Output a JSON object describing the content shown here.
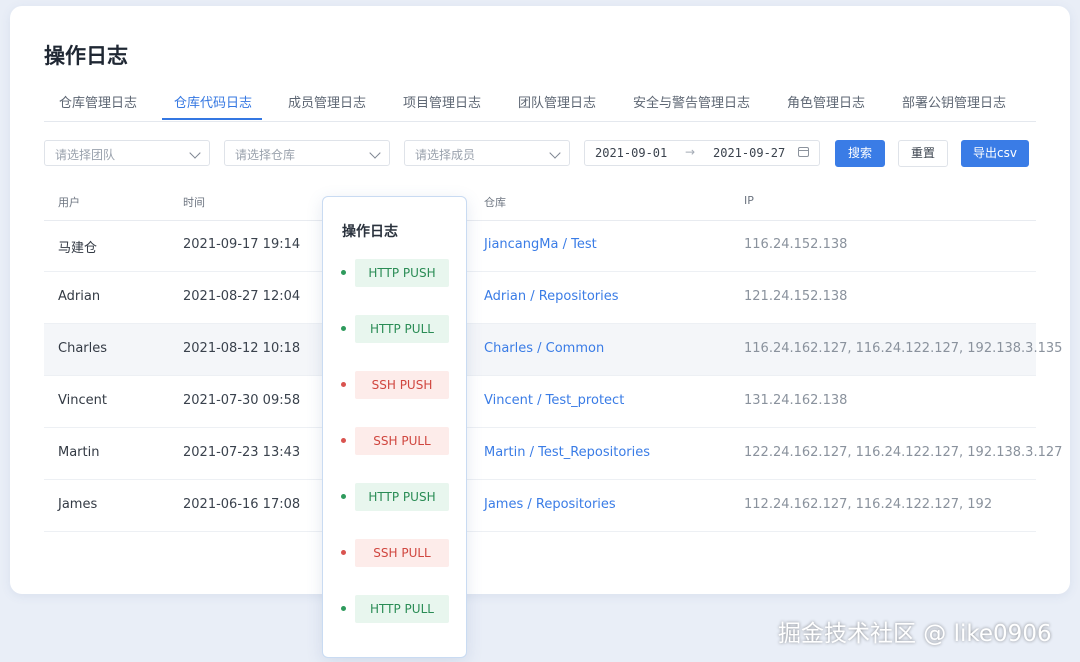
{
  "page": {
    "title": "操作日志"
  },
  "tabs": [
    {
      "label": "仓库管理日志"
    },
    {
      "label": "仓库代码日志"
    },
    {
      "label": "成员管理日志"
    },
    {
      "label": "项目管理日志"
    },
    {
      "label": "团队管理日志"
    },
    {
      "label": "安全与警告管理日志"
    },
    {
      "label": "角色管理日志"
    },
    {
      "label": "部署公钥管理日志"
    }
  ],
  "filters": {
    "team_placeholder": "请选择团队",
    "repo_placeholder": "请选择仓库",
    "member_placeholder": "请选择成员",
    "date_start": "2021-09-01",
    "date_arrow": "→",
    "date_end": "2021-09-27",
    "search_label": "搜索",
    "reset_label": "重置",
    "export_label": "导出csv"
  },
  "table": {
    "headers": {
      "user": "用户",
      "time": "时间",
      "repo": "仓库",
      "ip": "IP"
    },
    "rows": [
      {
        "user": "马建仓",
        "time": "2021-09-17 19:14",
        "repo": "JiancangMa / Test",
        "ip": "116.24.152.138"
      },
      {
        "user": "Adrian",
        "time": "2021-08-27 12:04",
        "repo": "Adrian / Repositories",
        "ip": "121.24.152.138"
      },
      {
        "user": "Charles",
        "time": "2021-08-12 10:18",
        "repo": "Charles / Common",
        "ip": "116.24.162.127, 116.24.122.127, 192.138.3.135"
      },
      {
        "user": "Vincent",
        "time": "2021-07-30 09:58",
        "repo": "Vincent / Test_protect",
        "ip": "131.24.162.138"
      },
      {
        "user": "Martin",
        "time": "2021-07-23 13:43",
        "repo": "Martin / Test_Repositories",
        "ip": "122.24.162.127, 116.24.122.127, 192.138.3.127"
      },
      {
        "user": "James",
        "time": "2021-06-16 17:08",
        "repo": "James / Repositories",
        "ip": "112.24.162.127, 116.24.122.127, 192"
      }
    ]
  },
  "popup": {
    "title": "操作日志",
    "ops": [
      {
        "label": "HTTP PUSH",
        "color": "#2a8c55"
      },
      {
        "label": "HTTP PULL",
        "color": "#2a8c55"
      },
      {
        "label": "SSH PUSH",
        "color": "#d0463f"
      },
      {
        "label": "SSH PULL",
        "color": "#d0463f"
      },
      {
        "label": "HTTP PUSH",
        "color": "#2a8c55"
      },
      {
        "label": "SSH PULL",
        "color": "#d0463f"
      },
      {
        "label": "HTTP PULL",
        "color": "#2a8c55"
      }
    ]
  },
  "watermark": "掘金技术社区 @ like0906",
  "colors": {
    "accent": "#3a7ce6",
    "success": "#2a8c55",
    "danger": "#d0463f"
  }
}
